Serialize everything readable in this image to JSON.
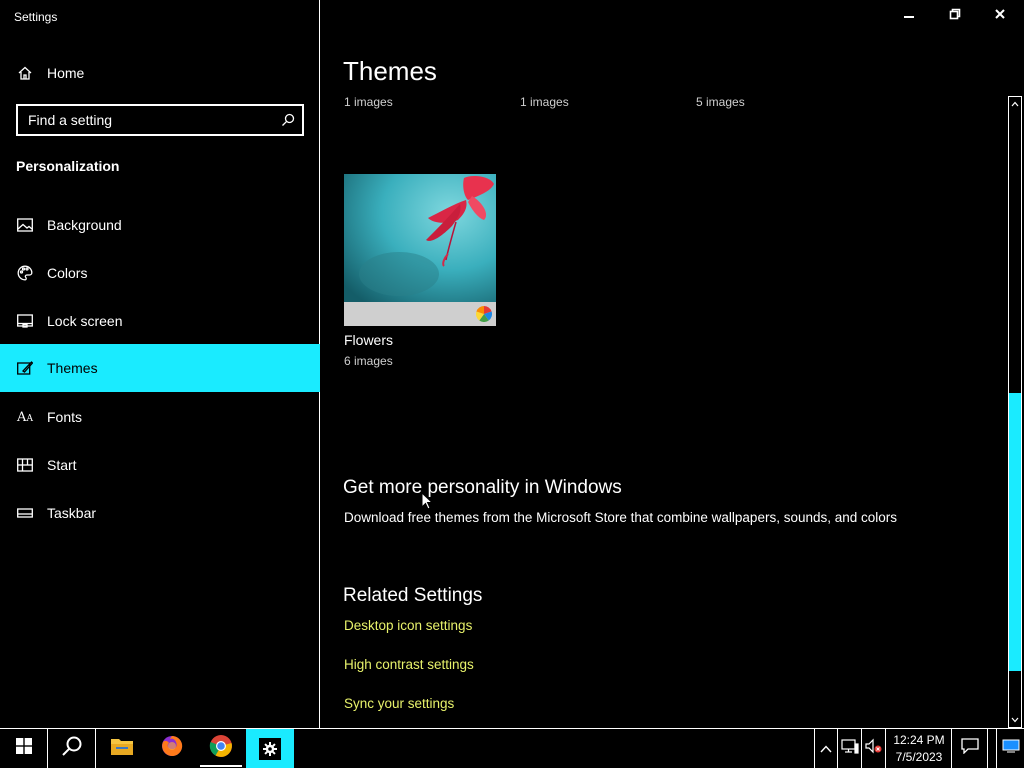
{
  "window": {
    "title": "Settings",
    "controls": [
      "minimize-icon",
      "restore-icon",
      "close-icon"
    ]
  },
  "sidebar": {
    "home_label": "Home",
    "search": {
      "placeholder": "Find a setting"
    },
    "section": "Personalization",
    "items": [
      {
        "label": "Background",
        "icon": "picture-icon"
      },
      {
        "label": "Colors",
        "icon": "palette-icon"
      },
      {
        "label": "Lock screen",
        "icon": "lock-screen-icon"
      },
      {
        "label": "Themes",
        "icon": "themes-icon",
        "active": true
      },
      {
        "label": "Fonts",
        "icon": "fonts-icon"
      },
      {
        "label": "Start",
        "icon": "start-icon"
      },
      {
        "label": "Taskbar",
        "icon": "taskbar-icon"
      }
    ]
  },
  "main": {
    "title": "Themes",
    "image_counts": [
      "1 images",
      "1 images",
      "5 images"
    ],
    "theme_card": {
      "name": "Flowers",
      "count": "6 images"
    },
    "more": {
      "heading": "Get more personality in Windows",
      "description": "Download free themes from the Microsoft Store that combine wallpapers, sounds, and colors"
    },
    "related": {
      "heading": "Related Settings",
      "links": [
        "Desktop icon settings",
        "High contrast settings",
        "Sync your settings"
      ]
    }
  },
  "taskbar": {
    "apps": [
      "start-icon",
      "search-icon",
      "file-explorer-icon",
      "firefox-icon",
      "chrome-icon",
      "settings-icon"
    ],
    "clock": {
      "time": "12:24 PM",
      "date": "7/5/2023"
    }
  },
  "colors": {
    "accent": "#1aebff",
    "link": "#e8f26b",
    "background": "#000000",
    "text": "#ffffff"
  }
}
